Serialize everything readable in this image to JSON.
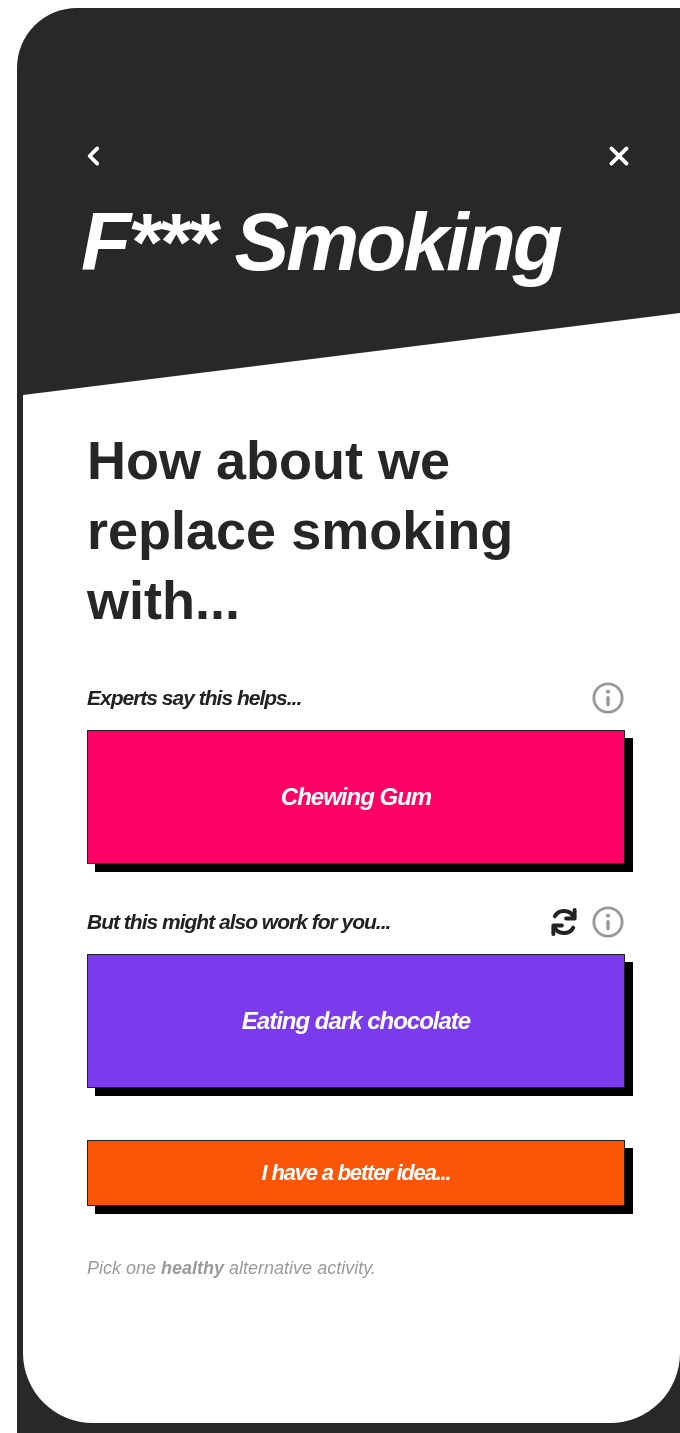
{
  "header": {
    "title": "F*** Smoking"
  },
  "heading": "How about we replace smoking with...",
  "sections": [
    {
      "label": "Experts say this helps...",
      "refresh": false,
      "option": {
        "label": "Chewing Gum",
        "color": "#ff0066"
      }
    },
    {
      "label": "But this might also work for you...",
      "refresh": true,
      "option": {
        "label": "Eating dark chocolate",
        "color": "#7c3aed"
      }
    }
  ],
  "better_idea_button": {
    "label": "I have a better idea..."
  },
  "footer": "Pick one **healthy** alternative activity."
}
